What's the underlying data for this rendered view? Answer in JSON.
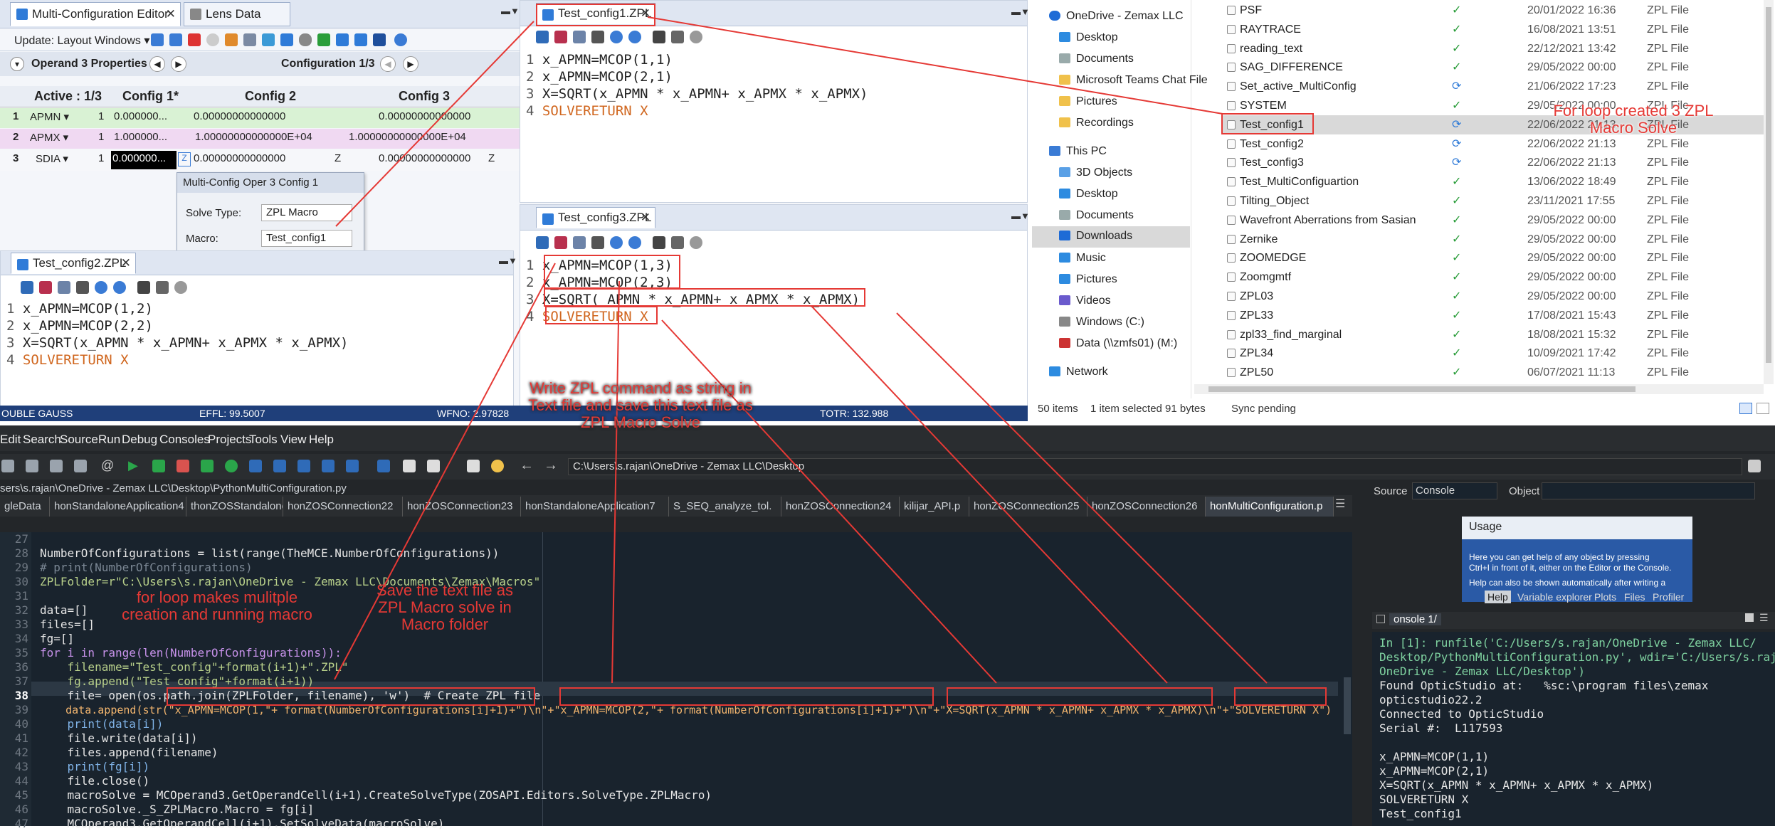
{
  "zemax": {
    "mce_tabs": [
      "Multi-Configuration Editor",
      "Lens Data"
    ],
    "mce_toolbar_label": "Update: Layout Windows ▾",
    "operand_label": "Operand  3 Properties",
    "config_label": "Configuration 1/3",
    "grid_headers": [
      "Active : 1/3",
      "Config 1*",
      "Config 2",
      "Config 3"
    ],
    "grid_rows": [
      {
        "num": "1",
        "op": "APMN ▾",
        "p": "1",
        "c1": "0.000000...",
        "c2": "0.00000000000000",
        "c3": "0.00000000000000"
      },
      {
        "num": "2",
        "op": "APMX ▾",
        "p": "1",
        "c1": "1.000000...",
        "c2": "1.00000000000000E+04",
        "c3": "1.00000000000000E+04"
      },
      {
        "num": "3",
        "op": "SDIA ▾",
        "p": "1",
        "c1": "0.000000...",
        "c2": "0.00000000000000",
        "c3": "0.00000000000000",
        "z1": "Z",
        "z2": "Z"
      }
    ],
    "popup_title": "Multi-Config Oper 3 Config 1",
    "solve_type_label": "Solve Type:",
    "solve_type_value": "ZPL Macro",
    "macro_label": "Macro:",
    "macro_value": "Test_config1",
    "editor1_tab": "Test_config1.ZPL",
    "editor2_tab": "Test_config2.ZPL",
    "editor3_tab": "Test_config3.ZPL",
    "editor1_lines": [
      "1",
      "x_APMN=",
      "MCOP",
      "(1,1)",
      "2",
      "x_APMN=",
      "MCOP",
      "(2,1)"
    ],
    "status": {
      "left": "OUBLE GAUSS",
      "effl": "EFFL: 99.5007",
      "wfno": "WFNO: 2.97828",
      "totr": "TOTR: 132.988"
    }
  },
  "code1": {
    "l1": "x_APMN=MCOP(1,1)",
    "l2": "x_APMN=MCOP(2,1)",
    "l3": "X=SQRT(x_APMN * x_APMN+ x_APMX * x_APMX)",
    "l4": "SOLVERETURN X"
  },
  "code2": {
    "l1": "x_APMN=MCOP(1,2)",
    "l2": "x_APMN=MCOP(2,2)",
    "l3": "X=SQRT(x_APMN * x_APMN+ x_APMX * x_APMX)",
    "l4": "SOLVERETURN X"
  },
  "code3": {
    "l1": "x_APMN=MCOP(1,3)",
    "l2": "x_APMN=MCOP(2,3)",
    "l3": "X=SQRT( APMN * x_APMN+ x APMX * x_APMX)",
    "l4": "SOLVERETURN X"
  },
  "explorer": {
    "nav": [
      "OneDrive - Zemax LLC",
      "Desktop",
      "Documents",
      "Microsoft Teams Chat File",
      "Pictures",
      "Recordings",
      "This PC",
      "3D Objects",
      "Desktop",
      "Documents",
      "Downloads",
      "Music",
      "Pictures",
      "Videos",
      "Windows (C:)",
      "Data (\\\\zmfs01) (M:)",
      "Network"
    ],
    "files": [
      {
        "name": "PSF",
        "date": "20/01/2022 16:36",
        "type": "ZPL File",
        "sync": "ok"
      },
      {
        "name": "RAYTRACE",
        "date": "16/08/2021 13:51",
        "type": "ZPL File",
        "sync": "ok"
      },
      {
        "name": "reading_text",
        "date": "22/12/2021 13:42",
        "type": "ZPL File",
        "sync": "ok"
      },
      {
        "name": "SAG_DIFFERENCE",
        "date": "29/05/2022 00:00",
        "type": "ZPL File",
        "sync": "ok"
      },
      {
        "name": "Set_active_MultiConfig",
        "date": "21/06/2022 17:23",
        "type": "ZPL File",
        "sync": "pending"
      },
      {
        "name": "SYSTEM",
        "date": "29/05/2022 00:00",
        "type": "ZPL File",
        "sync": "ok"
      },
      {
        "name": "Test_config1",
        "date": "22/06/2022 21:13",
        "type": "ZPL File",
        "sync": "pending"
      },
      {
        "name": "Test_config2",
        "date": "22/06/2022 21:13",
        "type": "ZPL File",
        "sync": "pending"
      },
      {
        "name": "Test_config3",
        "date": "22/06/2022 21:13",
        "type": "ZPL File",
        "sync": "pending"
      },
      {
        "name": "Test_MultiConfiguartion",
        "date": "13/06/2022 18:49",
        "type": "ZPL File",
        "sync": "ok"
      },
      {
        "name": "Tilting_Object",
        "date": "23/11/2021 17:55",
        "type": "ZPL File",
        "sync": "ok"
      },
      {
        "name": "Wavefront Aberrations from Sasian",
        "date": "29/05/2022 00:00",
        "type": "ZPL File",
        "sync": "ok"
      },
      {
        "name": "Zernike",
        "date": "29/05/2022 00:00",
        "type": "ZPL File",
        "sync": "ok"
      },
      {
        "name": "ZOOMEDGE",
        "date": "29/05/2022 00:00",
        "type": "ZPL File",
        "sync": "ok"
      },
      {
        "name": "Zoomgmtf",
        "date": "29/05/2022 00:00",
        "type": "ZPL File",
        "sync": "ok"
      },
      {
        "name": "ZPL03",
        "date": "29/05/2022 00:00",
        "type": "ZPL File",
        "sync": "ok"
      },
      {
        "name": "ZPL33",
        "date": "17/08/2021 15:43",
        "type": "ZPL File",
        "sync": "ok"
      },
      {
        "name": "zpl33_find_marginal",
        "date": "18/08/2021 15:32",
        "type": "ZPL File",
        "sync": "ok"
      },
      {
        "name": "ZPL34",
        "date": "10/09/2021 17:42",
        "type": "ZPL File",
        "sync": "ok"
      },
      {
        "name": "ZPL50",
        "date": "06/07/2021 11:13",
        "type": "ZPL File",
        "sync": "ok"
      }
    ],
    "status_items": "50 items",
    "status_selected": "1 item selected  91 bytes",
    "status_sync": "Sync pending"
  },
  "spyder": {
    "menu": [
      "Edit",
      "Search",
      "Source",
      "Run",
      "Debug",
      "Consoles",
      "Projects",
      "Tools",
      "View",
      "Help"
    ],
    "path": "C:\\Users\\s.rajan\\OneDrive - Zemax LLC\\Desktop",
    "file_path": "sers\\s.rajan\\OneDrive - Zemax LLC\\Desktop\\PythonMultiConfiguration.py",
    "file_tabs": [
      "gleData",
      "honStandaloneApplication4",
      "thonZOSStandalone.",
      "honZOSConnection22",
      "honZOSConnection23",
      "honStandaloneApplication7",
      "S_SEQ_analyze_tol.",
      "honZOSConnection24",
      "kilijar_API.p",
      "honZOSConnection25",
      "honZOSConnection26",
      "honMultiConfiguration.p"
    ],
    "source_label": "Source",
    "source_value": "Console",
    "object_label": "Object",
    "usage_title": "Usage",
    "usage_text1": "Here you can get help of any object by pressing",
    "usage_text2": "Ctrl+I in front of it, either on the Editor or the Console.",
    "usage_text3": "Help can also be shown automatically after writing a",
    "help_tabs": [
      "Help",
      "Variable explorer",
      "Plots",
      "Files",
      "Profiler"
    ],
    "console_tab": "onsole 1/",
    "console_lines": [
      "In [1]: runfile('C:/Users/s.rajan/OneDrive - Zemax LLC/",
      "Desktop/PythonMultiConfiguration.py', wdir='C:/Users/s.rajan/",
      "OneDrive - Zemax LLC/Desktop')",
      "Found OpticStudio at:   %sc:\\program files\\zemax",
      "opticstudio22.2",
      "Connected to OpticStudio",
      "Serial #:  L117593",
      "",
      "x_APMN=MCOP(1,1)",
      "x_APMN=MCOP(2,1)",
      "X=SQRT(x_APMN * x_APMN+ x_APMX * x_APMX)",
      "SOLVERETURN X",
      "Test_config1"
    ],
    "line_numbers": [
      "27",
      "28",
      "29",
      "30",
      "31",
      "32",
      "33",
      "34",
      "35",
      "36",
      "37",
      "38",
      "39",
      "40",
      "41",
      "42",
      "43",
      "44",
      "45",
      "46",
      "47"
    ],
    "code_lines": [
      "",
      "NumberOfConfigurations = list(range(TheMCE.NumberOfConfigurations))",
      "# print(NumberOfConfigurations)",
      "ZPLFolder=r\"C:\\Users\\s.rajan\\OneDrive - Zemax LLC\\Documents\\Zemax\\Macros\"",
      "",
      "data=[]",
      "files=[]",
      "fg=[]",
      "for i in range(len(NumberOfConfigurations)):",
      "    filename=\"Test_config\"+format(i+1)+\".ZPL\"",
      "    fg.append(\"Test_config\"+format(i+1))",
      "    file= open(os.path.join(ZPLFolder, filename), 'w')  # Create ZPL file",
      "    data.append(str(\"x_APMN=MCOP(1,\"+ format(NumberOfConfigurations[i]+1)+\")\\n\"+\"x_APMN=MCOP(2,\"+ format(NumberOfConfigurations[i]+1)+\")\\n\"+\"X=SQRT(x_APMN * x_APMN+ x_APMX * x_APMX)\\n\"+\"SOLVERETURN X\")",
      "    print(data[i])",
      "    file.write(data[i])",
      "    files.append(filename)",
      "    print(fg[i])",
      "    file.close()",
      "    macroSolve = MCOperand3.GetOperandCell(i+1).CreateSolveType(ZOSAPI.Editors.SolveType.ZPLMacro)",
      "    macroSolve._S_ZPLMacro.Macro = fg[i]",
      "    MCOperand3.GetOperandCell(i+1).SetSolveData(macroSolve)"
    ]
  },
  "annotations": {
    "a1": "For loop created 3 ZPL\nMacro Solve",
    "a2": "Write ZPL command as string in\nText file and save this text file as\nZPL Macro Solve",
    "a3": "for loop makes mulitple\ncreation and running macro",
    "a4": "Save the text file as\nZPL Macro solve in\nMacro folder"
  },
  "colors": {
    "annotation": "#e53935",
    "ide_bg": "#19232d",
    "zemax_bg": "#f4f6fa"
  }
}
